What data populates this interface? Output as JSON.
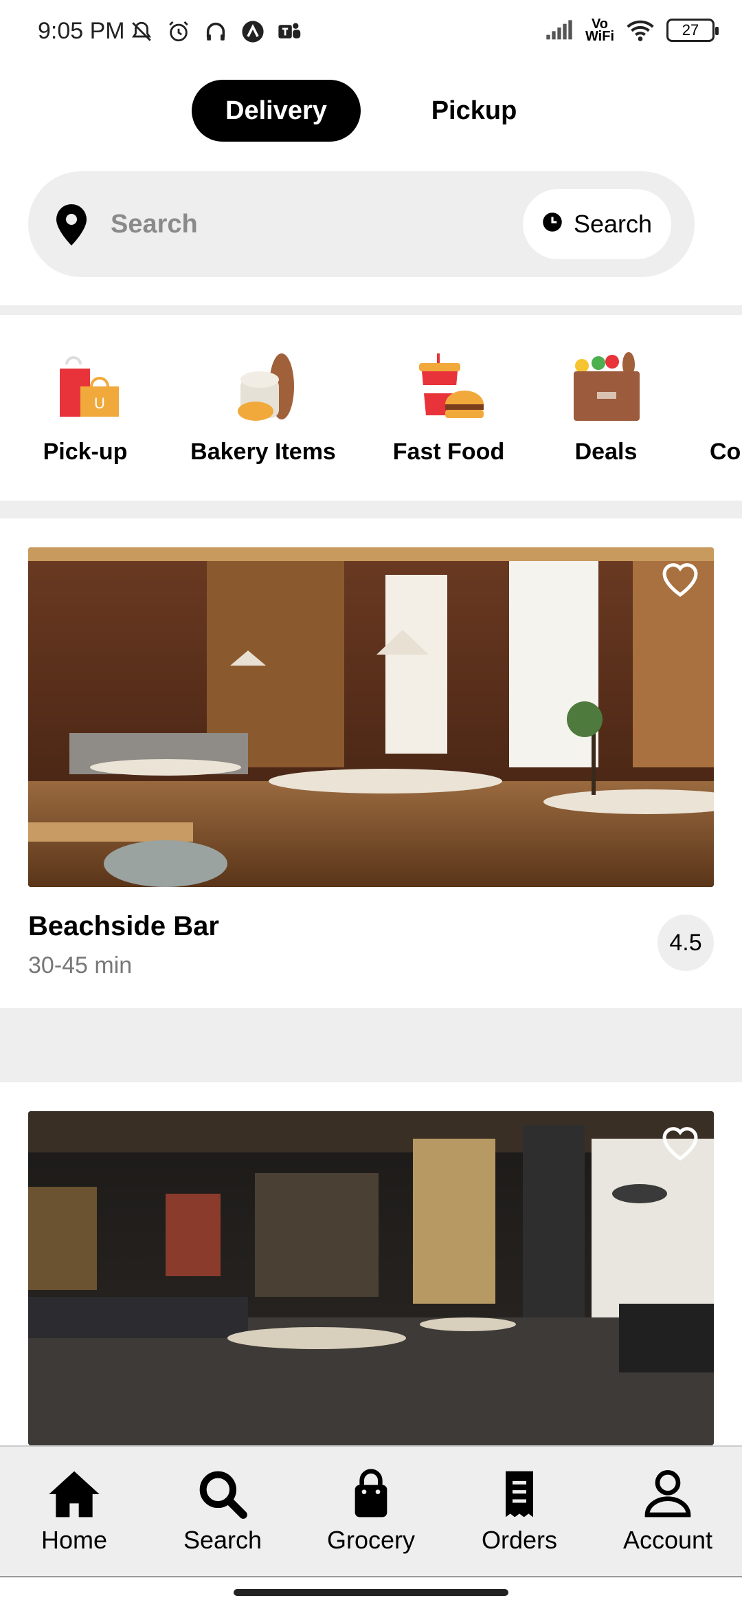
{
  "status_bar": {
    "time": "9:05 PM",
    "vowifi_top": "Vo",
    "vowifi_bottom": "WiFi",
    "battery": "27"
  },
  "toggle": {
    "delivery_label": "Delivery",
    "pickup_label": "Pickup"
  },
  "search": {
    "placeholder": "Search",
    "schedule_label": "Search"
  },
  "categories": [
    {
      "label": "Pick-up",
      "icon": "shopping-bags-icon"
    },
    {
      "label": "Bakery Items",
      "icon": "bread-icon"
    },
    {
      "label": "Fast Food",
      "icon": "soda-burger-icon"
    },
    {
      "label": "Deals",
      "icon": "grocery-bag-icon"
    },
    {
      "label": "Co",
      "icon": "partial-category-icon"
    }
  ],
  "restaurants": [
    {
      "name": "Beachside Bar",
      "time": "30-45 min",
      "rating": "4.5"
    },
    {
      "name": "",
      "time": "",
      "rating": ""
    }
  ],
  "bottom_nav": [
    {
      "label": "Home",
      "icon": "home-icon"
    },
    {
      "label": "Search",
      "icon": "search-icon"
    },
    {
      "label": "Grocery",
      "icon": "shopping-bag-icon"
    },
    {
      "label": "Orders",
      "icon": "receipt-icon"
    },
    {
      "label": "Account",
      "icon": "user-icon"
    }
  ],
  "colors": {
    "accent": "#000000",
    "background_gray": "#eeeeee",
    "muted_text": "#777777"
  }
}
